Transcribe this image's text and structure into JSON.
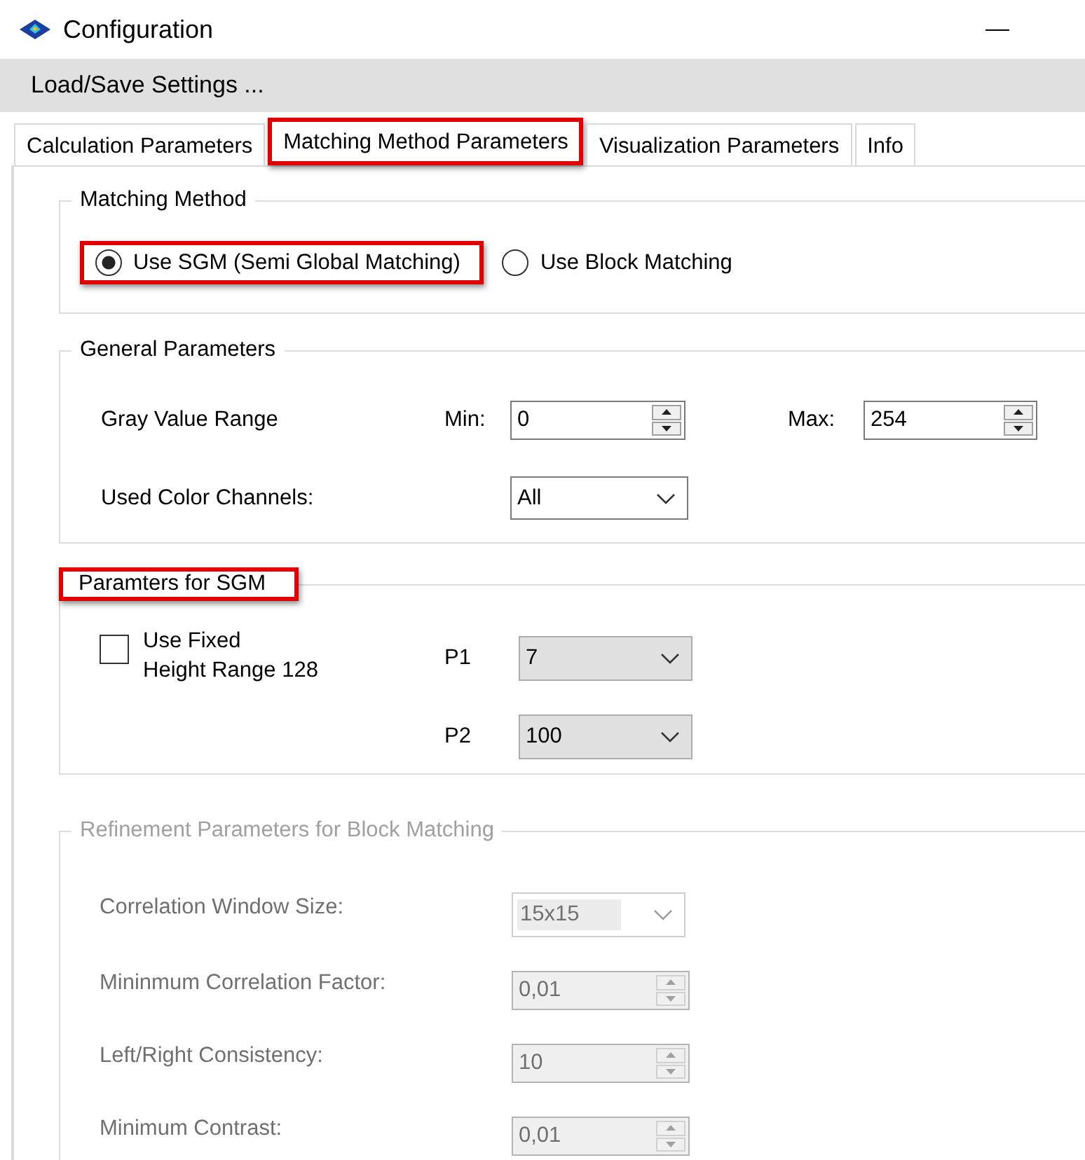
{
  "window": {
    "title": "Configuration"
  },
  "menu": {
    "items": [
      {
        "label": "Load/Save Settings ..."
      }
    ]
  },
  "tabs": [
    {
      "label": "Calculation Parameters",
      "selected": false,
      "highlighted": false
    },
    {
      "label": "Matching Method Parameters",
      "selected": true,
      "highlighted": true
    },
    {
      "label": "Visualization Parameters",
      "selected": false,
      "highlighted": false
    },
    {
      "label": "Info",
      "selected": false,
      "highlighted": false
    }
  ],
  "matching_method": {
    "title": "Matching Method",
    "options": [
      {
        "label": "Use SGM (Semi Global Matching)",
        "selected": true,
        "highlighted": true
      },
      {
        "label": "Use Block Matching",
        "selected": false,
        "highlighted": false
      }
    ]
  },
  "general_parameters": {
    "title": "General Parameters",
    "gray_value_range": {
      "label": "Gray Value Range",
      "min_label": "Min:",
      "min": "0",
      "max_label": "Max:",
      "max": "254"
    },
    "color_channels": {
      "label": "Used Color Channels:",
      "value": "All"
    }
  },
  "sgm": {
    "title": "Paramters for SGM",
    "highlighted": true,
    "fixed_height": {
      "label": "Use Fixed\nHeight Range 128",
      "checked": false
    },
    "p1": {
      "label": "P1",
      "value": "7"
    },
    "p2": {
      "label": "P2",
      "value": "100"
    }
  },
  "refinement": {
    "title": "Refinement Parameters for Block Matching",
    "disabled": true,
    "fields": [
      {
        "kind": "combo",
        "label": "Correlation Window Size:",
        "value": "15x15"
      },
      {
        "kind": "spin",
        "label": "Mininmum Correlation Factor:",
        "value": "0,01"
      },
      {
        "kind": "spin",
        "label": "Left/Right Consistency:",
        "value": "10"
      },
      {
        "kind": "spin",
        "label": "Minimum Contrast:",
        "value": "0,01"
      }
    ]
  }
}
